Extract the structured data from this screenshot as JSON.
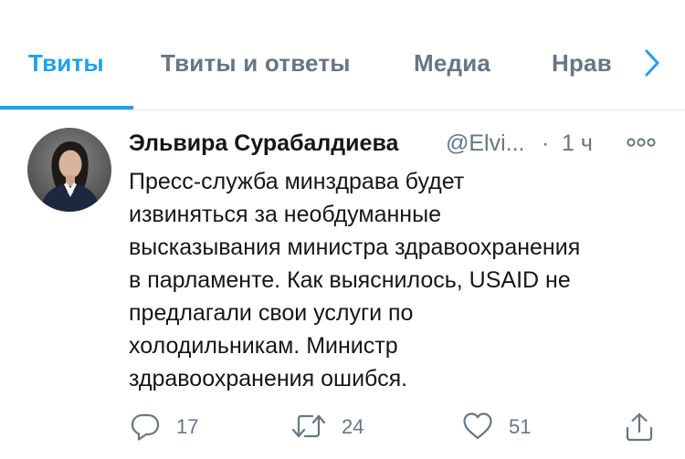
{
  "tabs": [
    {
      "label": "Твиты",
      "active": true
    },
    {
      "label": "Твиты и ответы",
      "active": false
    },
    {
      "label": "Медиа",
      "active": false
    },
    {
      "label": "Нрав",
      "active": false
    }
  ],
  "tweet": {
    "author_name": "Эльвира Сурабалдиева",
    "handle": "@Elvi...",
    "separator": "·",
    "time": "1 ч",
    "text_lines": [
      "Пресс-служба минздрава будет",
      "извиняться за необдуманные",
      "высказывания министра здравоохранения",
      "в парламенте. Как выяснилось, USAID не",
      "предлагали свои услуги по",
      "холодильникам. Министр",
      "здравоохранения ошибся."
    ],
    "replies": "17",
    "retweets": "24",
    "likes": "51"
  },
  "colors": {
    "accent": "#1da1f2",
    "secondary_text": "#657786",
    "primary_text": "#14171a",
    "divider": "#e1e8ed"
  },
  "icons": {
    "tabs_next": "chevron-right-icon",
    "more": "more-icon",
    "reply": "reply-icon",
    "retweet": "retweet-icon",
    "like": "heart-icon",
    "share": "share-icon"
  }
}
